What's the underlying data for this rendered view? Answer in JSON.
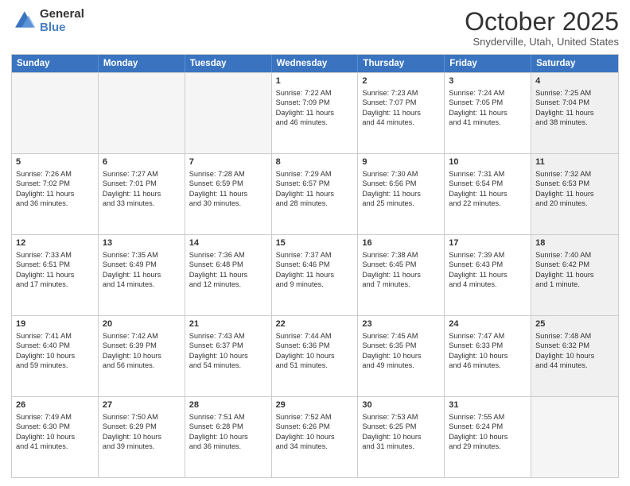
{
  "logo": {
    "general": "General",
    "blue": "Blue"
  },
  "header": {
    "month": "October 2025",
    "location": "Snyderville, Utah, United States"
  },
  "days": [
    "Sunday",
    "Monday",
    "Tuesday",
    "Wednesday",
    "Thursday",
    "Friday",
    "Saturday"
  ],
  "rows": [
    [
      {
        "day": "",
        "lines": [],
        "empty": true
      },
      {
        "day": "",
        "lines": [],
        "empty": true
      },
      {
        "day": "",
        "lines": [],
        "empty": true
      },
      {
        "day": "1",
        "lines": [
          "Sunrise: 7:22 AM",
          "Sunset: 7:09 PM",
          "Daylight: 11 hours",
          "and 46 minutes."
        ],
        "empty": false
      },
      {
        "day": "2",
        "lines": [
          "Sunrise: 7:23 AM",
          "Sunset: 7:07 PM",
          "Daylight: 11 hours",
          "and 44 minutes."
        ],
        "empty": false
      },
      {
        "day": "3",
        "lines": [
          "Sunrise: 7:24 AM",
          "Sunset: 7:05 PM",
          "Daylight: 11 hours",
          "and 41 minutes."
        ],
        "empty": false
      },
      {
        "day": "4",
        "lines": [
          "Sunrise: 7:25 AM",
          "Sunset: 7:04 PM",
          "Daylight: 11 hours",
          "and 38 minutes."
        ],
        "empty": false,
        "shaded": true
      }
    ],
    [
      {
        "day": "5",
        "lines": [
          "Sunrise: 7:26 AM",
          "Sunset: 7:02 PM",
          "Daylight: 11 hours",
          "and 36 minutes."
        ],
        "empty": false
      },
      {
        "day": "6",
        "lines": [
          "Sunrise: 7:27 AM",
          "Sunset: 7:01 PM",
          "Daylight: 11 hours",
          "and 33 minutes."
        ],
        "empty": false
      },
      {
        "day": "7",
        "lines": [
          "Sunrise: 7:28 AM",
          "Sunset: 6:59 PM",
          "Daylight: 11 hours",
          "and 30 minutes."
        ],
        "empty": false
      },
      {
        "day": "8",
        "lines": [
          "Sunrise: 7:29 AM",
          "Sunset: 6:57 PM",
          "Daylight: 11 hours",
          "and 28 minutes."
        ],
        "empty": false
      },
      {
        "day": "9",
        "lines": [
          "Sunrise: 7:30 AM",
          "Sunset: 6:56 PM",
          "Daylight: 11 hours",
          "and 25 minutes."
        ],
        "empty": false
      },
      {
        "day": "10",
        "lines": [
          "Sunrise: 7:31 AM",
          "Sunset: 6:54 PM",
          "Daylight: 11 hours",
          "and 22 minutes."
        ],
        "empty": false
      },
      {
        "day": "11",
        "lines": [
          "Sunrise: 7:32 AM",
          "Sunset: 6:53 PM",
          "Daylight: 11 hours",
          "and 20 minutes."
        ],
        "empty": false,
        "shaded": true
      }
    ],
    [
      {
        "day": "12",
        "lines": [
          "Sunrise: 7:33 AM",
          "Sunset: 6:51 PM",
          "Daylight: 11 hours",
          "and 17 minutes."
        ],
        "empty": false
      },
      {
        "day": "13",
        "lines": [
          "Sunrise: 7:35 AM",
          "Sunset: 6:49 PM",
          "Daylight: 11 hours",
          "and 14 minutes."
        ],
        "empty": false
      },
      {
        "day": "14",
        "lines": [
          "Sunrise: 7:36 AM",
          "Sunset: 6:48 PM",
          "Daylight: 11 hours",
          "and 12 minutes."
        ],
        "empty": false
      },
      {
        "day": "15",
        "lines": [
          "Sunrise: 7:37 AM",
          "Sunset: 6:46 PM",
          "Daylight: 11 hours",
          "and 9 minutes."
        ],
        "empty": false
      },
      {
        "day": "16",
        "lines": [
          "Sunrise: 7:38 AM",
          "Sunset: 6:45 PM",
          "Daylight: 11 hours",
          "and 7 minutes."
        ],
        "empty": false
      },
      {
        "day": "17",
        "lines": [
          "Sunrise: 7:39 AM",
          "Sunset: 6:43 PM",
          "Daylight: 11 hours",
          "and 4 minutes."
        ],
        "empty": false
      },
      {
        "day": "18",
        "lines": [
          "Sunrise: 7:40 AM",
          "Sunset: 6:42 PM",
          "Daylight: 11 hours",
          "and 1 minute."
        ],
        "empty": false,
        "shaded": true
      }
    ],
    [
      {
        "day": "19",
        "lines": [
          "Sunrise: 7:41 AM",
          "Sunset: 6:40 PM",
          "Daylight: 10 hours",
          "and 59 minutes."
        ],
        "empty": false
      },
      {
        "day": "20",
        "lines": [
          "Sunrise: 7:42 AM",
          "Sunset: 6:39 PM",
          "Daylight: 10 hours",
          "and 56 minutes."
        ],
        "empty": false
      },
      {
        "day": "21",
        "lines": [
          "Sunrise: 7:43 AM",
          "Sunset: 6:37 PM",
          "Daylight: 10 hours",
          "and 54 minutes."
        ],
        "empty": false
      },
      {
        "day": "22",
        "lines": [
          "Sunrise: 7:44 AM",
          "Sunset: 6:36 PM",
          "Daylight: 10 hours",
          "and 51 minutes."
        ],
        "empty": false
      },
      {
        "day": "23",
        "lines": [
          "Sunrise: 7:45 AM",
          "Sunset: 6:35 PM",
          "Daylight: 10 hours",
          "and 49 minutes."
        ],
        "empty": false
      },
      {
        "day": "24",
        "lines": [
          "Sunrise: 7:47 AM",
          "Sunset: 6:33 PM",
          "Daylight: 10 hours",
          "and 46 minutes."
        ],
        "empty": false
      },
      {
        "day": "25",
        "lines": [
          "Sunrise: 7:48 AM",
          "Sunset: 6:32 PM",
          "Daylight: 10 hours",
          "and 44 minutes."
        ],
        "empty": false,
        "shaded": true
      }
    ],
    [
      {
        "day": "26",
        "lines": [
          "Sunrise: 7:49 AM",
          "Sunset: 6:30 PM",
          "Daylight: 10 hours",
          "and 41 minutes."
        ],
        "empty": false
      },
      {
        "day": "27",
        "lines": [
          "Sunrise: 7:50 AM",
          "Sunset: 6:29 PM",
          "Daylight: 10 hours",
          "and 39 minutes."
        ],
        "empty": false
      },
      {
        "day": "28",
        "lines": [
          "Sunrise: 7:51 AM",
          "Sunset: 6:28 PM",
          "Daylight: 10 hours",
          "and 36 minutes."
        ],
        "empty": false
      },
      {
        "day": "29",
        "lines": [
          "Sunrise: 7:52 AM",
          "Sunset: 6:26 PM",
          "Daylight: 10 hours",
          "and 34 minutes."
        ],
        "empty": false
      },
      {
        "day": "30",
        "lines": [
          "Sunrise: 7:53 AM",
          "Sunset: 6:25 PM",
          "Daylight: 10 hours",
          "and 31 minutes."
        ],
        "empty": false
      },
      {
        "day": "31",
        "lines": [
          "Sunrise: 7:55 AM",
          "Sunset: 6:24 PM",
          "Daylight: 10 hours",
          "and 29 minutes."
        ],
        "empty": false
      },
      {
        "day": "",
        "lines": [],
        "empty": true,
        "shaded": true
      }
    ]
  ]
}
